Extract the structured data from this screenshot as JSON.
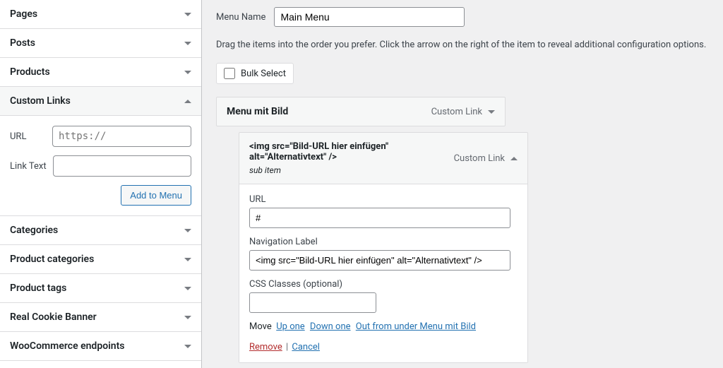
{
  "sidebar": {
    "items": [
      {
        "label": "Pages",
        "expanded": false
      },
      {
        "label": "Posts",
        "expanded": false
      },
      {
        "label": "Products",
        "expanded": false
      },
      {
        "label": "Custom Links",
        "expanded": true
      },
      {
        "label": "Categories",
        "expanded": false
      },
      {
        "label": "Product categories",
        "expanded": false
      },
      {
        "label": "Product tags",
        "expanded": false
      },
      {
        "label": "Real Cookie Banner",
        "expanded": false
      },
      {
        "label": "WooCommerce endpoints",
        "expanded": false
      }
    ],
    "customLinks": {
      "url_label": "URL",
      "url_placeholder": "https://",
      "linktext_label": "Link Text",
      "add_btn": "Add to Menu"
    }
  },
  "main": {
    "menu_name_label": "Menu Name",
    "menu_name_value": "Main Menu",
    "instructions": "Drag the items into the order you prefer. Click the arrow on the right of the item to reveal additional configuration options.",
    "bulk_select": "Bulk Select",
    "item1": {
      "title": "Menu mit Bild",
      "type": "Custom Link"
    },
    "item2": {
      "title": "<img src=\"Bild-URL hier einfügen\" alt=\"Alternativtext\" />",
      "sub": "sub item",
      "type": "Custom Link",
      "url_label": "URL",
      "url_value": "#",
      "navlabel_label": "Navigation Label",
      "navlabel_value": "<img src=\"Bild-URL hier einfügen\" alt=\"Alternativtext\" />",
      "css_label": "CSS Classes (optional)",
      "css_value": "",
      "move_label": "Move",
      "move_up": "Up one",
      "move_down": "Down one",
      "move_out": "Out from under Menu mit Bild",
      "remove": "Remove",
      "cancel": "Cancel"
    }
  }
}
